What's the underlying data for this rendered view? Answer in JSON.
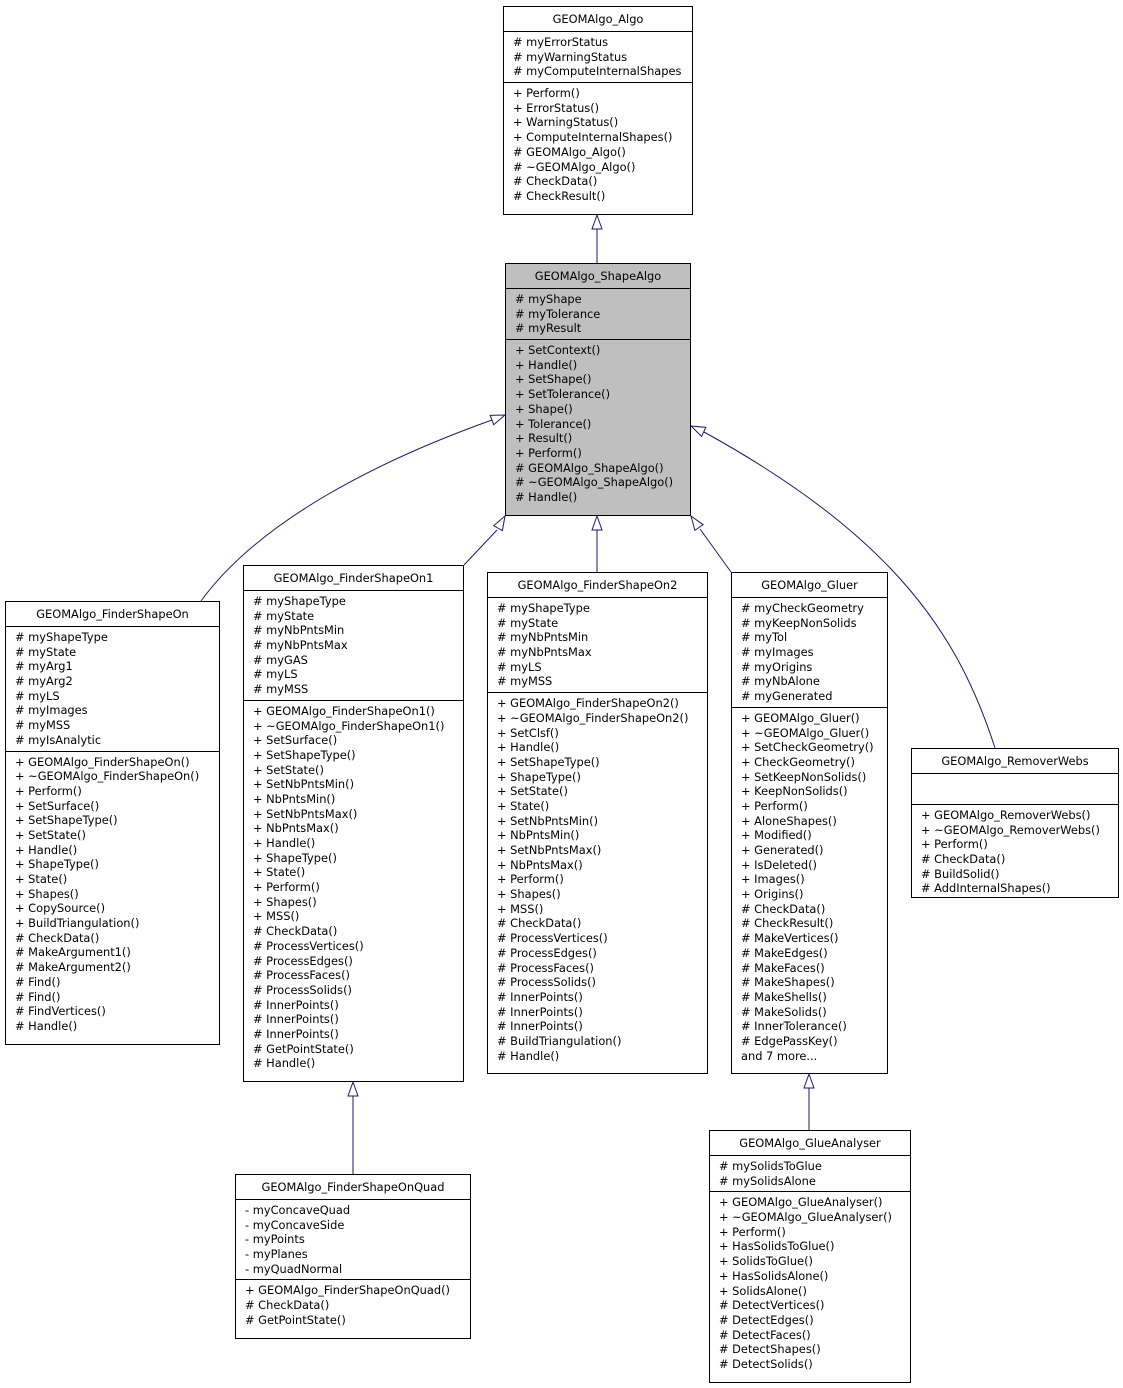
{
  "diagram": {
    "type": "class-inheritance",
    "colors": {
      "edge": "#191970",
      "highlight_fill": "#bfbfbf",
      "box_fill": "#ffffff",
      "border": "#000000"
    },
    "classes": [
      {
        "id": "algo",
        "name": "GEOMAlgo_Algo",
        "attributes": [
          "# myErrorStatus",
          "# myWarningStatus",
          "# myComputeInternalShapes"
        ],
        "methods": [
          "+ Perform()",
          "+ ErrorStatus()",
          "+ WarningStatus()",
          "+ ComputeInternalShapes()",
          "# GEOMAlgo_Algo()",
          "# ~GEOMAlgo_Algo()",
          "# CheckData()",
          "# CheckResult()"
        ]
      },
      {
        "id": "shapealgo",
        "name": "GEOMAlgo_ShapeAlgo",
        "highlighted": true,
        "attributes": [
          "# myShape",
          "# myTolerance",
          "# myResult"
        ],
        "methods": [
          "+ SetContext()",
          "+ Handle()",
          "+ SetShape()",
          "+ SetTolerance()",
          "+ Shape()",
          "+ Tolerance()",
          "+ Result()",
          "+ Perform()",
          "# GEOMAlgo_ShapeAlgo()",
          "# ~GEOMAlgo_ShapeAlgo()",
          "# Handle()"
        ]
      },
      {
        "id": "finderon",
        "name": "GEOMAlgo_FinderShapeOn",
        "attributes": [
          "# myShapeType",
          "# myState",
          "# myArg1",
          "# myArg2",
          "# myLS",
          "# myImages",
          "# myMSS",
          "# myIsAnalytic"
        ],
        "methods": [
          "+ GEOMAlgo_FinderShapeOn()",
          "+ ~GEOMAlgo_FinderShapeOn()",
          "+ Perform()",
          "+ SetSurface()",
          "+ SetShapeType()",
          "+ SetState()",
          "+ Handle()",
          "+ ShapeType()",
          "+ State()",
          "+ Shapes()",
          "+ CopySource()",
          "+ BuildTriangulation()",
          "# CheckData()",
          "# MakeArgument1()",
          "# MakeArgument2()",
          "# Find()",
          "# Find()",
          "# FindVertices()",
          "# Handle()"
        ]
      },
      {
        "id": "finderon1",
        "name": "GEOMAlgo_FinderShapeOn1",
        "attributes": [
          "# myShapeType",
          "# myState",
          "# myNbPntsMin",
          "# myNbPntsMax",
          "# myGAS",
          "# myLS",
          "# myMSS"
        ],
        "methods": [
          "+ GEOMAlgo_FinderShapeOn1()",
          "+ ~GEOMAlgo_FinderShapeOn1()",
          "+ SetSurface()",
          "+ SetShapeType()",
          "+ SetState()",
          "+ SetNbPntsMin()",
          "+ NbPntsMin()",
          "+ SetNbPntsMax()",
          "+ NbPntsMax()",
          "+ Handle()",
          "+ ShapeType()",
          "+ State()",
          "+ Perform()",
          "+ Shapes()",
          "+ MSS()",
          "# CheckData()",
          "# ProcessVertices()",
          "# ProcessEdges()",
          "# ProcessFaces()",
          "# ProcessSolids()",
          "# InnerPoints()",
          "# InnerPoints()",
          "# InnerPoints()",
          "# GetPointState()",
          "# Handle()"
        ]
      },
      {
        "id": "finderon2",
        "name": "GEOMAlgo_FinderShapeOn2",
        "attributes": [
          "# myShapeType",
          "# myState",
          "# myNbPntsMin",
          "# myNbPntsMax",
          "# myLS",
          "# myMSS"
        ],
        "methods": [
          "+ GEOMAlgo_FinderShapeOn2()",
          "+ ~GEOMAlgo_FinderShapeOn2()",
          "+ SetClsf()",
          "+ Handle()",
          "+ SetShapeType()",
          "+ ShapeType()",
          "+ SetState()",
          "+ State()",
          "+ SetNbPntsMin()",
          "+ NbPntsMin()",
          "+ SetNbPntsMax()",
          "+ NbPntsMax()",
          "+ Perform()",
          "+ Shapes()",
          "+ MSS()",
          "# CheckData()",
          "# ProcessVertices()",
          "# ProcessEdges()",
          "# ProcessFaces()",
          "# ProcessSolids()",
          "# InnerPoints()",
          "# InnerPoints()",
          "# InnerPoints()",
          "# BuildTriangulation()",
          "# Handle()"
        ]
      },
      {
        "id": "gluer",
        "name": "GEOMAlgo_Gluer",
        "attributes": [
          "# myCheckGeometry",
          "# myKeepNonSolids",
          "# myTol",
          "# myImages",
          "# myOrigins",
          "# myNbAlone",
          "# myGenerated"
        ],
        "methods": [
          "+ GEOMAlgo_Gluer()",
          "+ ~GEOMAlgo_Gluer()",
          "+ SetCheckGeometry()",
          "+ CheckGeometry()",
          "+ SetKeepNonSolids()",
          "+ KeepNonSolids()",
          "+ Perform()",
          "+ AloneShapes()",
          "+ Modified()",
          "+ Generated()",
          "+ IsDeleted()",
          "+ Images()",
          "+ Origins()",
          "# CheckData()",
          "# CheckResult()",
          "# MakeVertices()",
          "# MakeEdges()",
          "# MakeFaces()",
          "# MakeShapes()",
          "# MakeShells()",
          "# MakeSolids()",
          "# InnerTolerance()",
          "# EdgePassKey()",
          "and 7 more..."
        ]
      },
      {
        "id": "removerwebs",
        "name": "GEOMAlgo_RemoverWebs",
        "attributes": [],
        "methods": [
          "+ GEOMAlgo_RemoverWebs()",
          "+ ~GEOMAlgo_RemoverWebs()",
          "+ Perform()",
          "# CheckData()",
          "# BuildSolid()",
          "# AddInternalShapes()"
        ]
      },
      {
        "id": "finderonquad",
        "name": "GEOMAlgo_FinderShapeOnQuad",
        "attributes": [
          "- myConcaveQuad",
          "- myConcaveSide",
          "- myPoints",
          "- myPlanes",
          "- myQuadNormal"
        ],
        "methods": [
          "+ GEOMAlgo_FinderShapeOnQuad()",
          "# CheckData()",
          "# GetPointState()"
        ]
      },
      {
        "id": "glueanalyser",
        "name": "GEOMAlgo_GlueAnalyser",
        "attributes": [
          "# mySolidsToGlue",
          "# mySolidsAlone"
        ],
        "methods": [
          "+ GEOMAlgo_GlueAnalyser()",
          "+ ~GEOMAlgo_GlueAnalyser()",
          "+ Perform()",
          "+ HasSolidsToGlue()",
          "+ SolidsToGlue()",
          "+ HasSolidsAlone()",
          "+ SolidsAlone()",
          "# DetectVertices()",
          "# DetectEdges()",
          "# DetectFaces()",
          "# DetectShapes()",
          "# DetectSolids()"
        ]
      }
    ],
    "inheritance": [
      {
        "child": "shapealgo",
        "parent": "algo"
      },
      {
        "child": "finderon",
        "parent": "shapealgo"
      },
      {
        "child": "finderon1",
        "parent": "shapealgo"
      },
      {
        "child": "finderon2",
        "parent": "shapealgo"
      },
      {
        "child": "gluer",
        "parent": "shapealgo"
      },
      {
        "child": "removerwebs",
        "parent": "shapealgo"
      },
      {
        "child": "finderonquad",
        "parent": "finderon1"
      },
      {
        "child": "glueanalyser",
        "parent": "gluer"
      }
    ]
  }
}
